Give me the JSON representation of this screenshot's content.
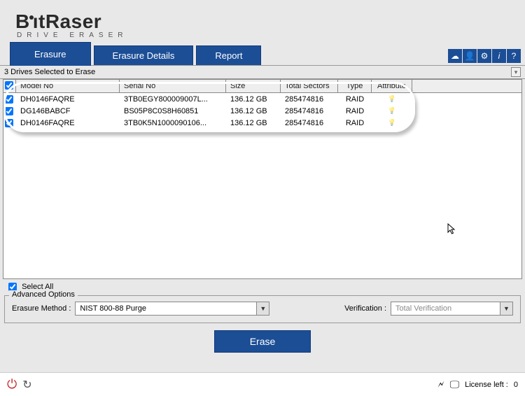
{
  "brand": {
    "main": "BitRaser",
    "sub": "DRIVE ERASER"
  },
  "tabs": {
    "erasure": "Erasure",
    "details": "Erasure Details",
    "report": "Report"
  },
  "toolbar": {
    "cloud": "cloud-icon",
    "user": "user-icon",
    "gear": "gear-icon",
    "info": "info-icon",
    "help": "help-icon"
  },
  "status": "3 Drives Selected to Erase",
  "columns": {
    "model": "Model No",
    "serial": "Serial No",
    "size": "Size",
    "sectors": "Total Sectors",
    "type": "Type",
    "attr": "Attribute"
  },
  "drives": [
    {
      "checked": true,
      "model": "DH0146FAQRE",
      "serial": "3TB0EGY800009007L...",
      "size": "136.12 GB",
      "sectors": "285474816",
      "type": "RAID"
    },
    {
      "checked": true,
      "model": "DG146BABCF",
      "serial": "BS05P8C0S8H60851",
      "size": "136.12 GB",
      "sectors": "285474816",
      "type": "RAID"
    },
    {
      "checked": true,
      "model": "DH0146FAQRE",
      "serial": "3TB0K5N1000090106...",
      "size": "136.12 GB",
      "sectors": "285474816",
      "type": "RAID"
    }
  ],
  "select_all": {
    "label": "Select All",
    "checked": true
  },
  "advanced": {
    "legend": "Advanced Options",
    "method_label": "Erasure Method :",
    "method_value": "NIST 800-88 Purge",
    "verify_label": "Verification :",
    "verify_value": "Total Verification"
  },
  "erase_button": "Erase",
  "footer": {
    "license_label": "License left :",
    "license_count": "0"
  }
}
